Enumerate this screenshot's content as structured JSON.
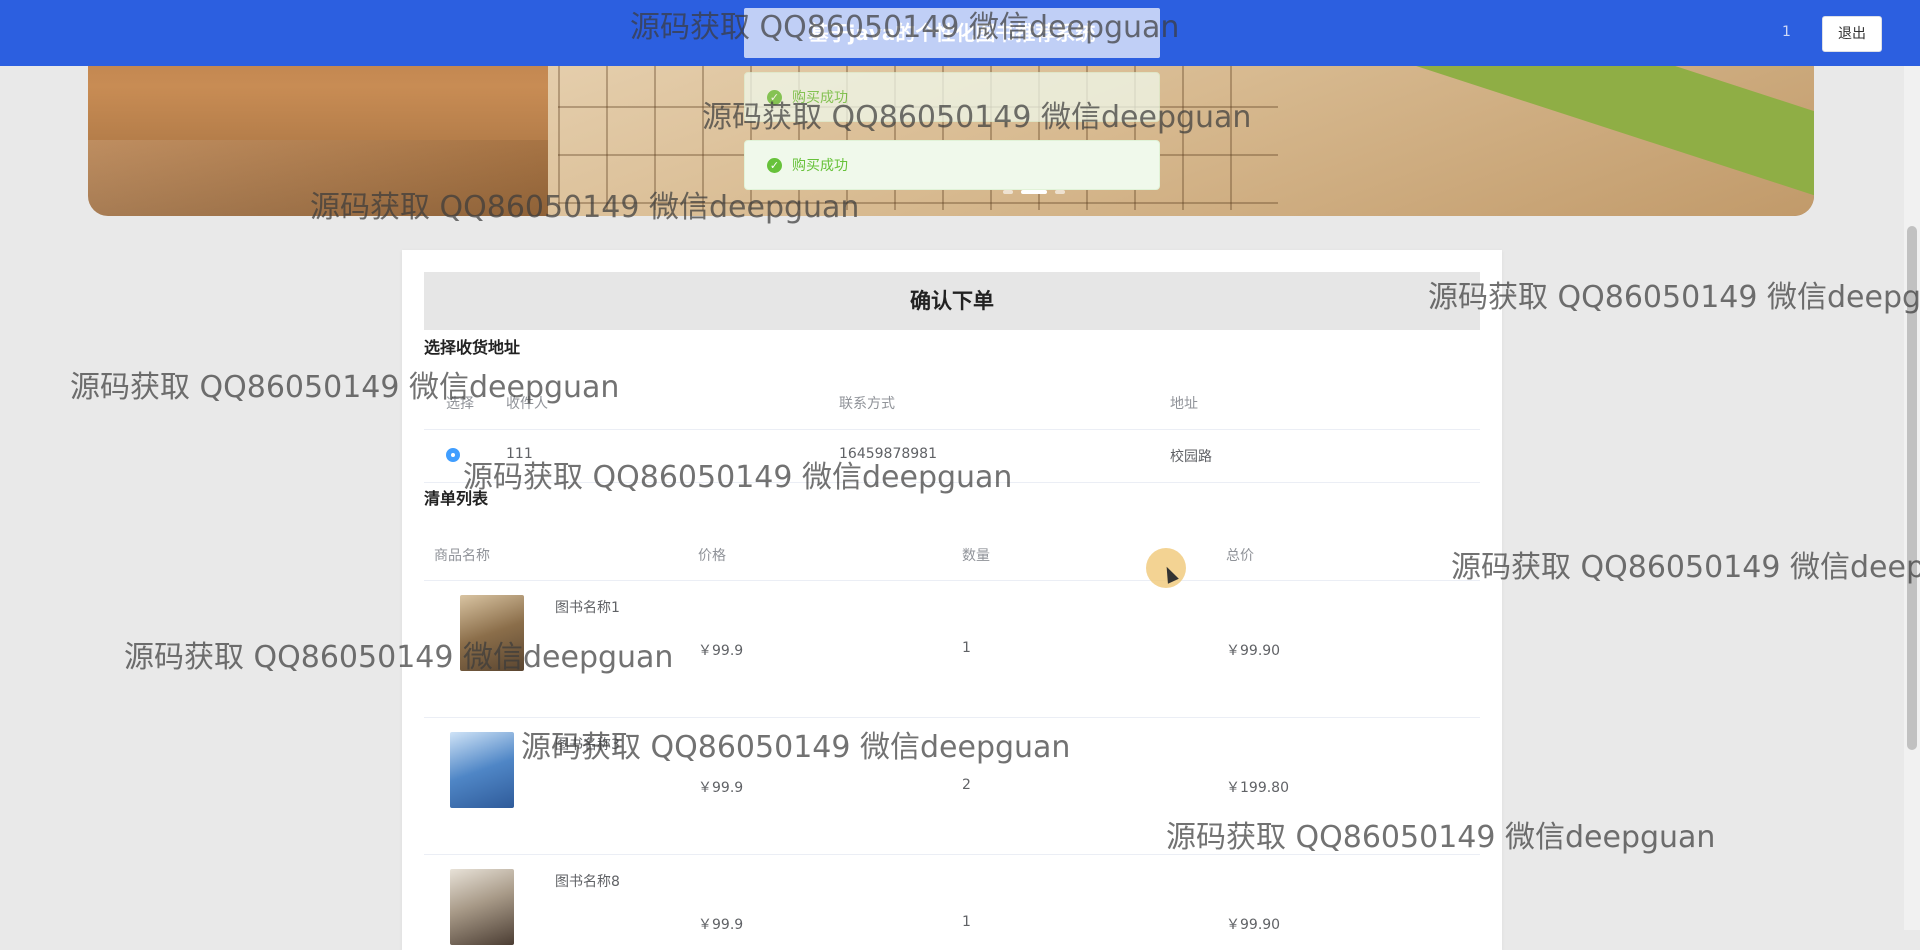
{
  "header": {
    "title": "基于java的个性化图书推荐系统",
    "user": "1",
    "logout_label": "退出"
  },
  "banner": {
    "dots": 3,
    "active_dot": 2
  },
  "toasts": [
    {
      "message": "购买成功"
    },
    {
      "message": "购买成功"
    }
  ],
  "order": {
    "title": "确认下单",
    "address_section": "选择收货地址",
    "address_columns": [
      "选择",
      "收件人",
      "联系方式",
      "地址"
    ],
    "addresses": [
      {
        "selected": true,
        "receiver": "111",
        "phone": "16459878981",
        "address": "校园路"
      }
    ],
    "items_section": "清单列表",
    "item_columns": [
      "商品名称",
      "价格",
      "数量",
      "总价"
    ],
    "items": [
      {
        "name": "图书名称1",
        "price": "￥99.9",
        "qty": "1",
        "total": "￥99.90"
      },
      {
        "name": "图书名称3",
        "price": "￥99.9",
        "qty": "2",
        "total": "￥199.80"
      },
      {
        "name": "图书名称8",
        "price": "￥99.9",
        "qty": "1",
        "total": "￥99.90"
      }
    ]
  },
  "watermark": "源码获取 QQ86050149 微信deepguan",
  "colors": {
    "topbar": "#2c5fe0",
    "success": "#67c23a",
    "radio": "#409eff"
  }
}
